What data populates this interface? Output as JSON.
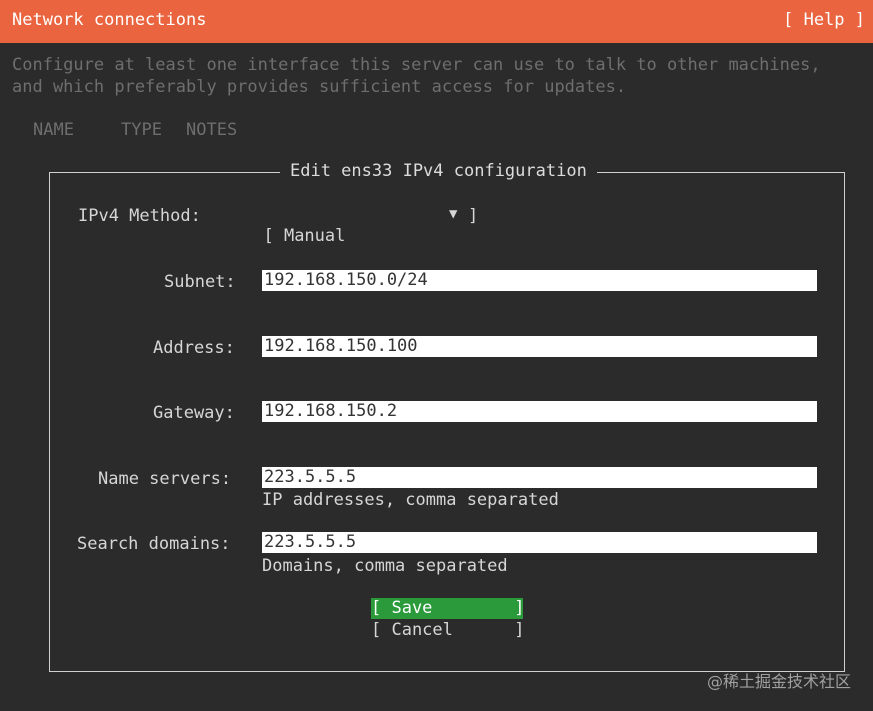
{
  "header": {
    "title": "Network connections",
    "help_label": "[ Help ]"
  },
  "intro": {
    "line1": "Configure at least one interface this server can use to talk to other machines,",
    "line2": "and which preferably provides sufficient access for updates."
  },
  "table": {
    "col_name": "NAME",
    "col_type": "TYPE",
    "col_notes": "NOTES"
  },
  "dialog": {
    "title": "Edit ens33 IPv4 configuration",
    "method_label": "IPv4 Method:",
    "method_value": "[ Manual",
    "method_close": "]",
    "method_arrow": "▼",
    "subnet_label": "Subnet:",
    "subnet_value": "192.168.150.0/24",
    "address_label": "Address:",
    "address_value": "192.168.150.100",
    "gateway_label": "Gateway:",
    "gateway_value": "192.168.150.2",
    "nameservers_label": "Name servers:",
    "nameservers_value": "223.5.5.5",
    "nameservers_hint": "IP addresses, comma separated",
    "searchdomains_label": "Search domains:",
    "searchdomains_value": "223.5.5.5",
    "searchdomains_hint": "Domains, comma separated",
    "save_label": "[ Save        ]",
    "cancel_label": "[ Cancel      ]"
  },
  "watermark": "@稀土掘金技术社区",
  "colors": {
    "header_bg": "#e9643f",
    "save_bg": "#2a9a3a",
    "screen_bg": "#2b2b2b"
  }
}
